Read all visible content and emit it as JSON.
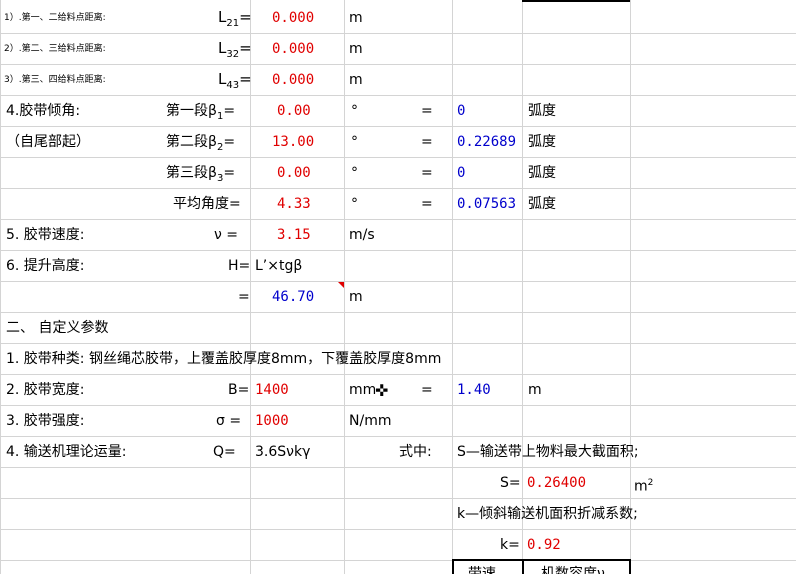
{
  "rows": {
    "r1": {
      "label": "1）.第一、二给料点距离:",
      "var": "L",
      "sub": "21",
      "eq": "=",
      "value": "0.000",
      "unit": "m"
    },
    "r2": {
      "label": "2）.第二、三给料点距离:",
      "var": "L",
      "sub": "32",
      "eq": "=",
      "value": "0.000",
      "unit": "m"
    },
    "r3": {
      "label": "3）.第三、四给料点距离:",
      "var": "L",
      "sub": "43",
      "eq": "=",
      "value": "0.000",
      "unit": "m"
    },
    "r4": {
      "label": "4.胶带倾角:",
      "seg": "第一段β",
      "sub": "1",
      "eq": "=",
      "value": "0.00",
      "unit": "°",
      "eq2": "=",
      "rad": "0",
      "radunit": "弧度"
    },
    "r5": {
      "label": "（自尾部起）",
      "seg": "第二段β",
      "sub": "2",
      "eq": "=",
      "value": "13.00",
      "unit": "°",
      "eq2": "=",
      "rad": "0.22689",
      "radunit": "弧度"
    },
    "r6": {
      "seg": "第三段β",
      "sub": "3",
      "eq": "=",
      "value": "0.00",
      "unit": "°",
      "eq2": "=",
      "rad": "0",
      "radunit": "弧度"
    },
    "r7": {
      "seg": "平均角度=",
      "value": "4.33",
      "unit": "°",
      "eq2": "=",
      "rad": "0.07563",
      "radunit": "弧度"
    },
    "r8": {
      "label": "5. 胶带速度:",
      "var": "ν =",
      "value": "3.15",
      "unit": "m/s"
    },
    "r9": {
      "label": "6. 提升高度:",
      "var": "H=",
      "formula": "L’×tgβ"
    },
    "r10": {
      "var": "=",
      "value": "46.70",
      "unit": "m"
    },
    "r11": {
      "label": "二、 自定义参数"
    },
    "r12": {
      "label": "1. 胶带种类: 钢丝绳芯胶带，上覆盖胶厚度8mm，下覆盖胶厚度8mm"
    },
    "r13": {
      "label": "2. 胶带宽度:",
      "var": "B=",
      "value": "1400",
      "unit": "mm",
      "eq2": "=",
      "value2": "1.40",
      "unit2": "m"
    },
    "r14": {
      "label": "3. 胶带强度:",
      "var": "σ =",
      "value": "1000",
      "unit": "N/mm"
    },
    "r15": {
      "label": "4. 输送机理论运量:",
      "var": "Q=",
      "formula": "3.6Sνkγ",
      "note": "式中:",
      "desc": "S—输送带上物料最大截面积;"
    },
    "r16": {
      "var": "S=",
      "value": "0.26400",
      "unit": "m",
      "unit_sup": "2"
    },
    "r17": {
      "desc": "k—倾斜输送机面积折减系数;"
    },
    "r18": {
      "var": "k=",
      "value": "0.92"
    },
    "r19": {
      "col1": "带速",
      "col2": "机数容度ν"
    }
  },
  "colors": {
    "input": "#e00000",
    "computed": "#0000cc",
    "grid": "#d4d4d4"
  }
}
